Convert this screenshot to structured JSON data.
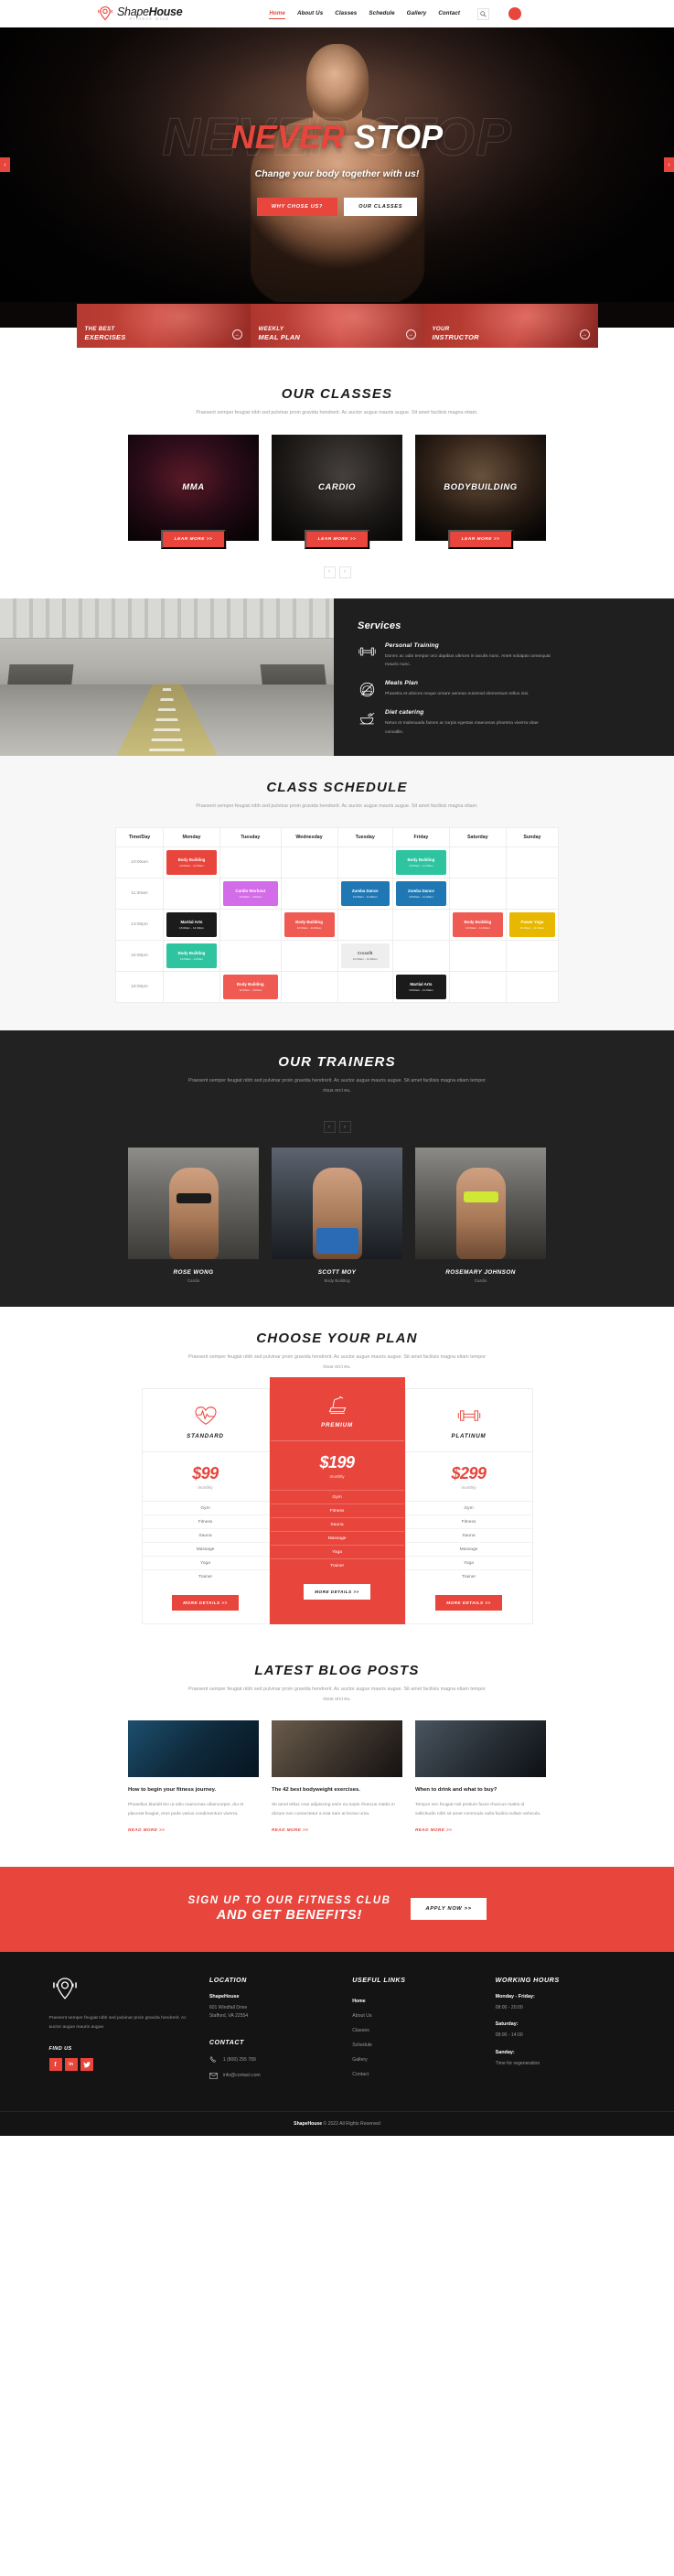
{
  "brand": {
    "name_light": "Shape",
    "name_bold": "House",
    "tagline": "Fitness Club"
  },
  "nav": {
    "items": [
      {
        "label": "Home",
        "active": true
      },
      {
        "label": "About Us",
        "active": false
      },
      {
        "label": "Classes",
        "active": false
      },
      {
        "label": "Schedule",
        "active": false
      },
      {
        "label": "Gallery",
        "active": false
      },
      {
        "label": "Contact",
        "active": false
      }
    ],
    "search_icon": "search-icon",
    "accent_color": "#e8453c"
  },
  "hero": {
    "ghost_text": "NEVER STOP",
    "title_red": "NEVER",
    "title_white": " STOP",
    "subtitle": "Change your body together with us!",
    "btn_primary": "WHY CHOSE US?",
    "btn_secondary": "OUR CLASSES",
    "prev_icon": "chevron-left-icon",
    "next_icon": "chevron-right-icon"
  },
  "feature_bar": [
    {
      "line1": "THE BEST",
      "line2": "EXERCISES",
      "arrow": "arrow-right-circle-icon"
    },
    {
      "line1": "WEEKLY",
      "line2": "MEAL PLAN",
      "arrow": "arrow-right-circle-icon"
    },
    {
      "line1": "YOUR",
      "line2": "INSTRUCTOR",
      "arrow": "arrow-right-circle-icon"
    }
  ],
  "classes": {
    "title": "OUR CLASSES",
    "desc": "Praesent semper feugiat nibh sed pulvinar proin gravida hendrerit. Ac auctor augue mauris augue. Sit amet facilisis magna etiam.",
    "cards": [
      {
        "name": "MMA",
        "button": "LEAR MORE >>"
      },
      {
        "name": "CARDIO",
        "button": "LEAR MORE >>"
      },
      {
        "name": "BODYBUILDING",
        "button": "LEAR MORE >>"
      }
    ],
    "prev": "‹",
    "next": "›"
  },
  "services": {
    "title": "Services",
    "items": [
      {
        "icon": "dumbbell-icon",
        "title": "Personal Training",
        "desc": "Donec ac odio tempor orci dapibus ultrices in iaculis nunc. Amet volutpat consequat mauris nunc."
      },
      {
        "icon": "no-fastfood-icon",
        "title": "Meals Plan",
        "desc": "Pharetra et ultrices neque ornare aenean euismod elementum tellus nisi."
      },
      {
        "icon": "bowl-spoon-icon",
        "title": "Diet catering",
        "desc": "Netus et malesuada fames ac turpis egestas maecenas pharetra viverra vitae convallis."
      }
    ]
  },
  "schedule": {
    "title": "CLASS SCHEDULE",
    "desc": "Praesent semper feugiat nibh sed pulvinar proin gravida hendrerit. Ac auctor augue mauris augue. Sit amet facilisis magna etiam.",
    "columns": [
      "Time/Day",
      "Monday",
      "Tuesday",
      "Wednesday",
      "Tuesday",
      "Friday",
      "Saturday",
      "Sunday"
    ],
    "rows": [
      {
        "time": "10:00am",
        "cells": [
          {
            "name": "Body Building",
            "time": "10:00am - 11:00am",
            "color": "ev-red"
          },
          null,
          null,
          null,
          {
            "name": "Body Building",
            "time": "10:00am - 11:00am",
            "color": "ev-green"
          },
          null
        ]
      },
      {
        "time": "11:30am",
        "cells": [
          null,
          {
            "name": "Cardio Workout",
            "time": "12:00am - 2:00am",
            "color": "ev-purple"
          },
          null,
          {
            "name": "Zumba Dance",
            "time": "10:00am - 11:00am",
            "color": "ev-blue"
          },
          {
            "name": "Zumba Dance",
            "time": "10:00am - 11:00am",
            "color": "ev-blue"
          },
          null,
          null
        ]
      },
      {
        "time": "13:00pm",
        "cells": [
          {
            "name": "Martial Arts",
            "time": "13:00pm - 14:30pm",
            "color": "ev-black"
          },
          null,
          {
            "name": "Body Building",
            "time": "10:00am - 11:00am",
            "color": "ev-redlight"
          },
          null,
          null,
          {
            "name": "Body Building",
            "time": "10:00am - 11:00am",
            "color": "ev-redlight"
          },
          {
            "name": "Power Yoga",
            "time": "10:00am - 11:00am",
            "color": "ev-yellow"
          }
        ]
      },
      {
        "time": "15:00pm",
        "cells": [
          {
            "name": "Body Building",
            "time": "12:00am - 2:00am",
            "color": "ev-green"
          },
          null,
          null,
          {
            "name": "Crossfit",
            "time": "10:00am - 11:00am",
            "color": "ev-gray"
          },
          null,
          null,
          null
        ]
      },
      {
        "time": "18:00pm",
        "cells": [
          null,
          {
            "name": "Body Building",
            "time": "12:00am - 2:00am",
            "color": "ev-redlight"
          },
          null,
          null,
          {
            "name": "Martial Arts",
            "time": "10:00am - 11:00am",
            "color": "ev-black"
          },
          null,
          null
        ]
      }
    ]
  },
  "trainers": {
    "title": "OUR TRAINERS",
    "desc": "Praesent semper feugiat nibh sed pulvinar proin gravida hendrerit. Ac auctor augue mauris augue. Sit amet facilisis magna etiam tempor risus orci eu.",
    "prev": "‹",
    "next": "›",
    "cards": [
      {
        "name": "ROSE WONG",
        "role": "Cardio"
      },
      {
        "name": "SCOTT MOY",
        "role": "Body Building"
      },
      {
        "name": "ROSEMARY JOHNSON",
        "role": "Cardio"
      }
    ]
  },
  "plans": {
    "title": "CHOOSE YOUR PLAN",
    "desc": "Praesent semper feugiat nibh sed pulvinar proin gravida hendrerit. Ac auctor augue mauris augue. Sit amet facilisis magna etiam tempor risus orci eu.",
    "items": [
      {
        "icon": "heartbeat-icon",
        "name": "STANDARD",
        "price": "$99",
        "per": "monthly",
        "features": [
          "Gym",
          "Fitness",
          "Sauna",
          "Massage",
          "Yoga",
          "Trainer"
        ],
        "button": "MORE DETAILS >>"
      },
      {
        "icon": "treadmill-icon",
        "name": "PREMIUM",
        "price": "$199",
        "per": "monthly",
        "features": [
          "Gym",
          "Fitness",
          "Sauna",
          "Massage",
          "Yoga",
          "Trainer"
        ],
        "button": "MORE DETAILS >>"
      },
      {
        "icon": "dumbbell-icon",
        "name": "PLATINUM",
        "price": "$299",
        "per": "monthly",
        "features": [
          "Gym",
          "Fitness",
          "Sauna",
          "Massage",
          "Yoga",
          "Trainer"
        ],
        "button": "MORE DETAILS >>"
      }
    ]
  },
  "blog": {
    "title": "LATEST BLOG POSTS",
    "desc": "Praesent semper feugiat nibh sed pulvinar proin gravida hendrerit. Ac auctor augue mauris augue. Sit amet facilisis magna etiam tempor risus orci eu.",
    "posts": [
      {
        "title": "How to begin your fitness journey.",
        "excerpt": "Phasellus blandit leo ut odio maecenas ullamcorper, dui et placerat feugiat, eros pede varius condimentum viverra.",
        "more": "READ MORE >>"
      },
      {
        "title": "The 42 best bodyweight exercises.",
        "excerpt": "Sit amet tellus cras adipiscing enim eu turpis rhoncus mattis in dictum non consectetur a erat nam at lectus urna.",
        "more": "READ MORE >>"
      },
      {
        "title": "When to drink and what to buy?",
        "excerpt": "Tempor nec feugiat nisl pretium fusce rhoncus mattis id sollicitudin nibh sit amet commodo nulla facilisi nullam vehicula.",
        "more": "READ MORE >>"
      }
    ]
  },
  "cta": {
    "line1": "SIGN UP TO OUR FITNESS CLUB",
    "line2": "AND GET BENEFITS!",
    "button": "APPLY NOW >>"
  },
  "footer": {
    "logo_icon": "shapehouse-mark-icon",
    "about": "Praesent semper feugiat nibh sed pulvinar proin gravida hendrerit. Ac auctor augue mauris augue.",
    "find_us": "FIND US",
    "socials": [
      {
        "icon": "facebook-icon",
        "glyph": "f"
      },
      {
        "icon": "linkedin-icon",
        "glyph": "in"
      },
      {
        "icon": "twitter-icon",
        "glyph": "🐦"
      }
    ],
    "location": {
      "heading": "LOCATION",
      "company": "ShapeHouse",
      "address1": "601 Windfall Drive",
      "address2": "Stafford, VA 22554"
    },
    "contact": {
      "heading": "CONTACT",
      "phone_icon": "phone-icon",
      "phone": "1 (800) 255 789",
      "email_icon": "envelope-icon",
      "email": "info@contact.com"
    },
    "useful_links": {
      "heading": "USEFUL LINKS",
      "items": [
        {
          "label": "Home",
          "active": true
        },
        {
          "label": "About Us",
          "active": false
        },
        {
          "label": "Classes",
          "active": false
        },
        {
          "label": "Schedule",
          "active": false
        },
        {
          "label": "Gallery",
          "active": false
        },
        {
          "label": "Contact",
          "active": false
        }
      ]
    },
    "working_hours": {
      "heading": "WORKING HOURS",
      "blocks": [
        {
          "label": "Monday - Friday:",
          "value": "08:00 - 20:00"
        },
        {
          "label": "Saturday:",
          "value": "08:00 - 14:00"
        },
        {
          "label": "Sanday:",
          "value": "Time for regeneration"
        }
      ]
    },
    "copyright_brand": "ShapeHouse",
    "copyright_rest": " © 2022 All Rights Reserved"
  }
}
